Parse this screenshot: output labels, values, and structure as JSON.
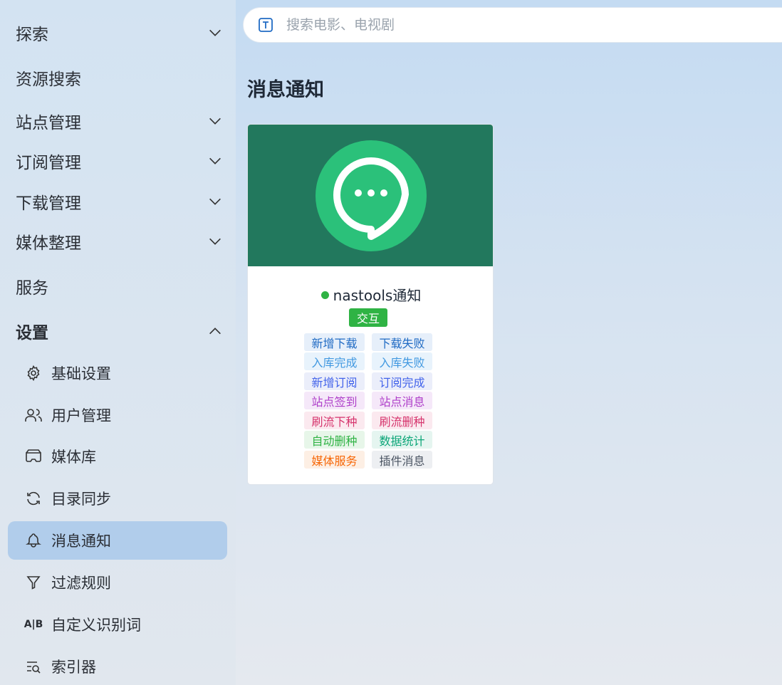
{
  "sidebar": {
    "groups": {
      "explore": "探索",
      "resource_search": "资源搜索",
      "site_manage": "站点管理",
      "subscribe_manage": "订阅管理",
      "download_manage": "下载管理",
      "media_organize": "媒体整理",
      "service": "服务",
      "settings": "设置"
    },
    "settings_items": {
      "basic": "基础设置",
      "users": "用户管理",
      "library": "媒体库",
      "sync": "目录同步",
      "notify": "消息通知",
      "filter": "过滤规则",
      "words": "自定义识别词",
      "indexer": "索引器"
    },
    "words_icon_text": "A|B"
  },
  "search": {
    "placeholder": "搜索电影、电视剧"
  },
  "page": {
    "title": "消息通知"
  },
  "card": {
    "name": "nastools通知",
    "badge": "交互",
    "tags": [
      "新增下载",
      "下载失败",
      "入库完成",
      "入库失败",
      "新增订阅",
      "订阅完成",
      "站点签到",
      "站点消息",
      "刷流下种",
      "刷流删种",
      "自动删种",
      "数据统计",
      "媒体服务",
      "插件消息"
    ]
  },
  "colors": {
    "active_nav": "#b1cdeb",
    "banner": "#22785d",
    "logo": "#2bc17a",
    "status_green": "#2fb344"
  }
}
